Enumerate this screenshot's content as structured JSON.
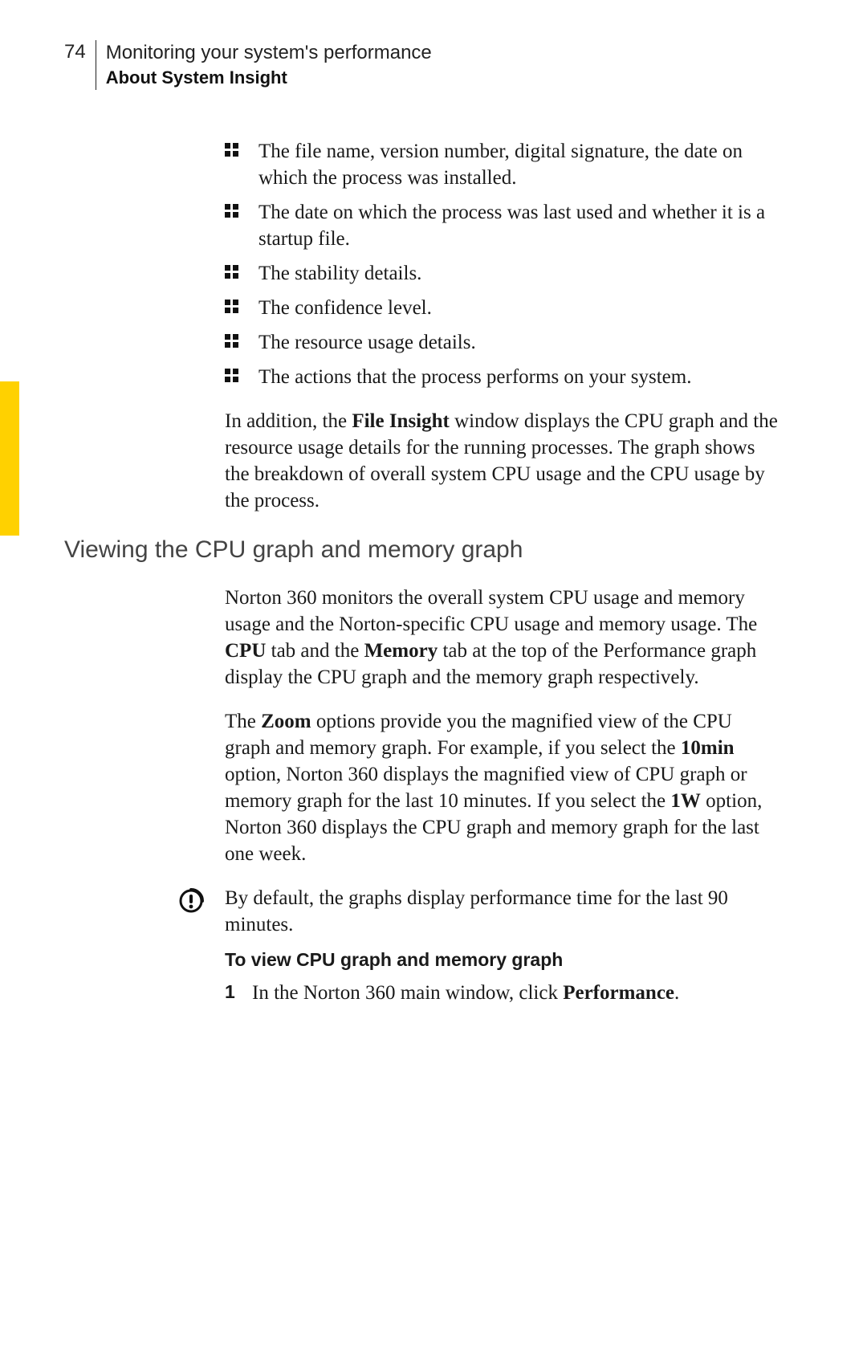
{
  "header": {
    "page_number": "74",
    "chapter": "Monitoring your system's performance",
    "section": "About System Insight"
  },
  "bullets": [
    "The file name, version number, digital signature, the date on which the process was installed.",
    "The date on which the process was last used and whether it is a startup file.",
    "The stability details.",
    "The confidence level.",
    "The resource usage details.",
    "The actions that the process performs on your system."
  ],
  "para1": {
    "pre": "In addition, the ",
    "bold1": "File Insight",
    "post": " window displays the CPU graph and the resource usage details for the running processes. The graph shows the breakdown of overall system CPU usage and the CPU usage by the process."
  },
  "section_title": "Viewing the CPU graph and memory graph",
  "para2": {
    "t1": "Norton 360 monitors the overall system CPU usage and memory usage and the Norton-specific CPU usage and memory usage. The ",
    "b1": "CPU",
    "t2": " tab and the ",
    "b2": "Memory",
    "t3": " tab at the top of the Performance graph display the CPU graph and the memory graph respectively."
  },
  "para3": {
    "t1": "The ",
    "b1": "Zoom",
    "t2": " options provide you the magnified view of the CPU graph and memory graph. For example, if you select the ",
    "b2": "10min",
    "t3": " option, Norton 360 displays the magnified view of CPU graph or memory graph for the last 10 minutes. If you select the ",
    "b3": "1W",
    "t4": " option, Norton 360 displays the CPU graph and memory graph for the last one week."
  },
  "note": "By default, the graphs display performance time for the last 90 minutes.",
  "task_title": "To view CPU graph and memory graph",
  "step1": {
    "num": "1",
    "t1": "In the Norton 360 main window, click ",
    "b1": "Performance",
    "t2": "."
  },
  "icons": {
    "bullet": "four-square-bullet-icon",
    "note": "alert-circle-icon"
  }
}
